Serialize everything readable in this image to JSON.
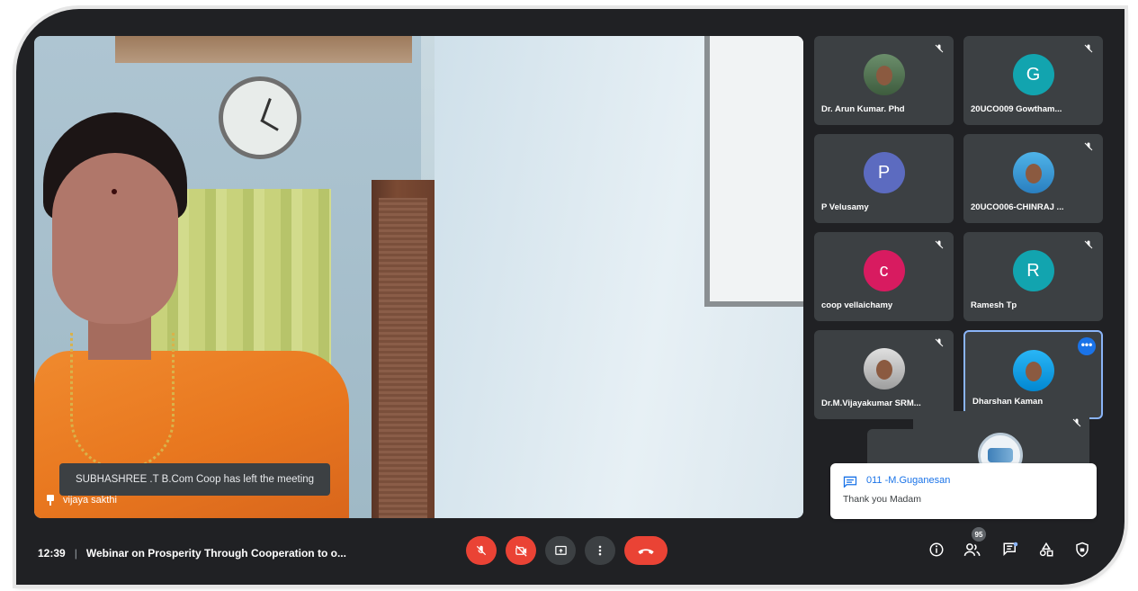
{
  "main_video": {
    "speaker_name": "vijaya sakthi",
    "toast": "SUBHASHREE .T B.Com Coop has left the meeting"
  },
  "participants": [
    {
      "name": "Dr. Arun Kumar. Phd",
      "avatar_type": "photo",
      "muted": true
    },
    {
      "name": "20UCO009 Gowtham...",
      "avatar_letter": "G",
      "avatar_color": "#12a4af",
      "muted": true
    },
    {
      "name": "P Velusamy",
      "avatar_letter": "P",
      "avatar_color": "#5c6bc0",
      "muted": false
    },
    {
      "name": "20UCO006-CHINRAJ ...",
      "avatar_type": "photo",
      "muted": true
    },
    {
      "name": "coop vellaichamy",
      "avatar_letter": "c",
      "avatar_color": "#d81b60",
      "muted": true
    },
    {
      "name": "Ramesh Tp",
      "avatar_letter": "R",
      "avatar_color": "#12a4af",
      "muted": true
    },
    {
      "name": "Dr.M.Vijayakumar SRM...",
      "avatar_type": "photo",
      "muted": true
    },
    {
      "name": "Dharshan Kaman",
      "avatar_type": "photo",
      "active": true
    }
  ],
  "chat_notification": {
    "sender": "011 -M.Guganesan",
    "message": "Thank you Madam"
  },
  "bottom_bar": {
    "time": "12:39",
    "separator": "|",
    "meeting_title": "Webinar on Prosperity Through Cooperation to o...",
    "participant_count": "95"
  },
  "icons": {
    "mic_off": "mic-off-icon",
    "cam_off": "camera-off-icon",
    "present": "present-screen-icon",
    "more": "more-vert-icon",
    "end_call": "end-call-icon",
    "info": "info-icon",
    "people": "people-icon",
    "chat": "chat-icon",
    "activities": "activities-icon",
    "lock": "host-controls-icon"
  },
  "colors": {
    "red": "#ea4335",
    "tile_bg": "#3c4043",
    "accent_blue": "#1a73e8"
  }
}
